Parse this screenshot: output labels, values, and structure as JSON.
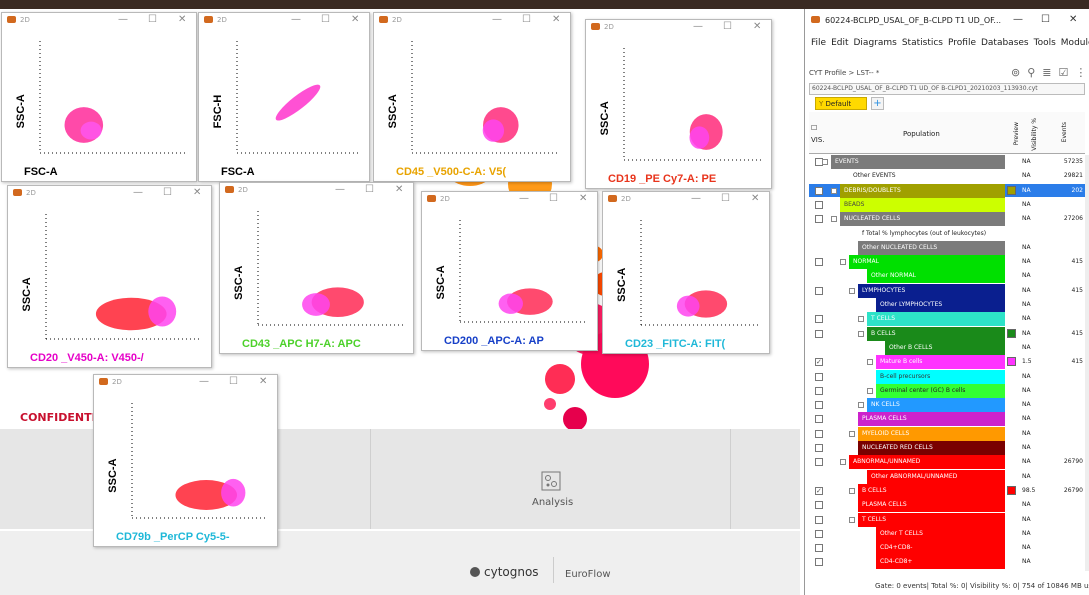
{
  "os": {
    "topbar_color": "#3a2a22"
  },
  "background_app": {
    "confidential_label": "CONFIDENTIAL:",
    "analysis_label": "Analysis",
    "brand_cytognos": "cytognos",
    "brand_euroflow": "EuroFlow"
  },
  "plots": [
    {
      "title": "2D",
      "x_label": "FSC-A",
      "y_label": "SSC-A",
      "x_color": "#000000",
      "shape": "cluster_low_left"
    },
    {
      "title": "2D",
      "x_label": "FSC-A",
      "y_label": "FSC-H",
      "x_color": "#000000",
      "shape": "diagonal"
    },
    {
      "title": "2D",
      "x_label": "CD45 _V500-C-A: V5(",
      "y_label": "SSC-A",
      "x_color": "#e8a300",
      "shape": "cluster_right"
    },
    {
      "title": "2D",
      "x_label": "CD19 _PE Cy7-A: PE",
      "y_label": "SSC-A",
      "x_color": "#e8341c",
      "shape": "cluster_right"
    },
    {
      "title": "2D",
      "x_label": "CD20 _V450-A: V450-/",
      "y_label": "SSC-A",
      "x_color": "#e600c8",
      "shape": "cluster_spread"
    },
    {
      "title": "2D",
      "x_label": "CD43 _APC H7-A: APC",
      "y_label": "SSC-A",
      "x_color": "#4cd12a",
      "shape": "cluster_mid"
    },
    {
      "title": "2D",
      "x_label": "CD200 _APC-A: AP",
      "y_label": "SSC-A",
      "x_color": "#1740c8",
      "shape": "cluster_mid"
    },
    {
      "title": "2D",
      "x_label": "CD23 _FITC-A: FIT(",
      "y_label": "SSC-A",
      "x_color": "#1fb8d8",
      "shape": "cluster_mid"
    },
    {
      "title": "2D",
      "x_label": "CD79b _PerCP Cy5-5-",
      "y_label": "SSC-A",
      "x_color": "#1fb8d8",
      "shape": "cluster_spread"
    }
  ],
  "panel": {
    "title": "60224-BCLPD_USAL_OF_B-CLPD T1 UD_OF...",
    "menu": [
      "File",
      "Edit",
      "Diagrams",
      "Statistics",
      "Profile",
      "Databases",
      "Tools",
      "Modules",
      "Help"
    ],
    "breadcrumb": "CYT Profile > LST-- *",
    "file_path": "60224-BCLPD_USAL_OF_B-CLPD T1 UD_OF B-CLPD1_20210203_113930.cyt",
    "tab": "Default Tree",
    "col_vis": "VIS.",
    "col_population": "Population",
    "col_preview": "Preview",
    "col_visibility": "Visibility %",
    "col_events": "Events",
    "status": "Gate: 0 events| Total %: 0| Visibility %: 0| 754 of 10846 MB used",
    "rows": [
      {
        "label": "EVENTS",
        "bg": "#7b7b7b",
        "fg": "#ffffff",
        "indent": 0,
        "vis": "NA",
        "ev": "57235",
        "cb": true,
        "checked": false,
        "exp": true
      },
      {
        "label": "Other EVENTS",
        "bg": "#ffffff",
        "fg": "#222222",
        "indent": 2,
        "vis": "NA",
        "ev": "29821",
        "cb": false,
        "checked": false,
        "exp": false
      },
      {
        "label": "DEBRIS/DOUBLETS",
        "bg": "#a0a000",
        "fg": "#ffffff",
        "indent": 1,
        "vis": "NA",
        "ev": "202",
        "cb": true,
        "checked": false,
        "exp": true,
        "selected": true
      },
      {
        "label": "BEADS",
        "bg": "#ccff00",
        "fg": "#444444",
        "indent": 1,
        "vis": "NA",
        "ev": "",
        "cb": true,
        "checked": false,
        "exp": false
      },
      {
        "label": "NUCLEATED CELLS",
        "bg": "#7b7b7b",
        "fg": "#ffffff",
        "indent": 1,
        "vis": "NA",
        "ev": "27206",
        "cb": true,
        "checked": false,
        "exp": true
      },
      {
        "label": "f  Total % lymphocytes (out of leukocytes)",
        "bg": "#ffffff",
        "fg": "#222222",
        "indent": 3,
        "vis": "",
        "ev": "",
        "cb": false,
        "checked": false,
        "exp": false
      },
      {
        "label": "Other NUCLEATED CELLS",
        "bg": "#7b7b7b",
        "fg": "#ffffff",
        "indent": 3,
        "vis": "NA",
        "ev": "",
        "cb": false,
        "checked": false,
        "exp": false
      },
      {
        "label": "NORMAL",
        "bg": "#00e000",
        "fg": "#ffffff",
        "indent": 2,
        "vis": "NA",
        "ev": "415",
        "cb": true,
        "checked": false,
        "exp": true
      },
      {
        "label": "Other NORMAL",
        "bg": "#00e000",
        "fg": "#ffffff",
        "indent": 4,
        "vis": "NA",
        "ev": "",
        "cb": false,
        "checked": false,
        "exp": false
      },
      {
        "label": "LYMPHOCYTES",
        "bg": "#0a1f8f",
        "fg": "#ffffff",
        "indent": 3,
        "vis": "NA",
        "ev": "415",
        "cb": true,
        "checked": false,
        "exp": true
      },
      {
        "label": "Other LYMPHOCYTES",
        "bg": "#0a1f8f",
        "fg": "#ffffff",
        "indent": 5,
        "vis": "NA",
        "ev": "",
        "cb": false,
        "checked": false,
        "exp": false
      },
      {
        "label": "T CELLS",
        "bg": "#2de3c8",
        "fg": "#ffffff",
        "indent": 4,
        "vis": "NA",
        "ev": "",
        "cb": true,
        "checked": false,
        "exp": true
      },
      {
        "label": "B CELLS",
        "bg": "#1a8a1a",
        "fg": "#ffffff",
        "indent": 4,
        "vis": "NA",
        "ev": "415",
        "cb": true,
        "checked": false,
        "exp": true
      },
      {
        "label": "Other B CELLS",
        "bg": "#1a8a1a",
        "fg": "#ffffff",
        "indent": 6,
        "vis": "NA",
        "ev": "",
        "cb": false,
        "checked": false,
        "exp": false
      },
      {
        "label": "Mature B cells",
        "bg": "#ff33ff",
        "fg": "#ffffff",
        "indent": 5,
        "vis": "1.5",
        "ev": "415",
        "cb": true,
        "checked": true,
        "exp": true
      },
      {
        "label": "B-cell precursors",
        "bg": "#00ffff",
        "fg": "#333333",
        "indent": 5,
        "vis": "NA",
        "ev": "",
        "cb": true,
        "checked": false,
        "exp": false
      },
      {
        "label": "Germinal center (GC) B cells",
        "bg": "#33ff33",
        "fg": "#222222",
        "indent": 5,
        "vis": "NA",
        "ev": "",
        "cb": true,
        "checked": false,
        "exp": true
      },
      {
        "label": "NK CELLS",
        "bg": "#2299ff",
        "fg": "#ffffff",
        "indent": 4,
        "vis": "NA",
        "ev": "",
        "cb": true,
        "checked": false,
        "exp": true
      },
      {
        "label": "PLASMA CELLS",
        "bg": "#cc22cc",
        "fg": "#ffffff",
        "indent": 3,
        "vis": "NA",
        "ev": "",
        "cb": true,
        "checked": false,
        "exp": false
      },
      {
        "label": "MYELOID CELLS",
        "bg": "#ff9900",
        "fg": "#ffffff",
        "indent": 3,
        "vis": "NA",
        "ev": "",
        "cb": true,
        "checked": false,
        "exp": true
      },
      {
        "label": "NUCLEATED RED CELLS",
        "bg": "#7a0000",
        "fg": "#ffffff",
        "indent": 3,
        "vis": "NA",
        "ev": "",
        "cb": true,
        "checked": false,
        "exp": false
      },
      {
        "label": "ABNORMAL/UNNAMED",
        "bg": "#ff0000",
        "fg": "#ffffff",
        "indent": 2,
        "vis": "NA",
        "ev": "26790",
        "cb": true,
        "checked": false,
        "exp": true
      },
      {
        "label": "Other ABNORMAL/UNNAMED",
        "bg": "#ff0000",
        "fg": "#ffffff",
        "indent": 4,
        "vis": "NA",
        "ev": "",
        "cb": false,
        "checked": false,
        "exp": false
      },
      {
        "label": "B CELLS",
        "bg": "#ff0000",
        "fg": "#ffffff",
        "indent": 3,
        "vis": "98.5",
        "ev": "26790",
        "cb": true,
        "checked": true,
        "exp": true
      },
      {
        "label": "PLASMA CELLS",
        "bg": "#ff0000",
        "fg": "#ffffff",
        "indent": 3,
        "vis": "NA",
        "ev": "",
        "cb": true,
        "checked": false,
        "exp": false
      },
      {
        "label": "T CELLS",
        "bg": "#ff0000",
        "fg": "#ffffff",
        "indent": 3,
        "vis": "NA",
        "ev": "",
        "cb": true,
        "checked": false,
        "exp": true
      },
      {
        "label": "Other T CELLS",
        "bg": "#ff0000",
        "fg": "#ffffff",
        "indent": 5,
        "vis": "NA",
        "ev": "",
        "cb": true,
        "checked": false,
        "exp": false
      },
      {
        "label": "CD4+CD8-",
        "bg": "#ff0000",
        "fg": "#ffffff",
        "indent": 5,
        "vis": "NA",
        "ev": "",
        "cb": true,
        "checked": false,
        "exp": false
      },
      {
        "label": "CD4-CD8+",
        "bg": "#ff0000",
        "fg": "#ffffff",
        "indent": 5,
        "vis": "NA",
        "ev": "",
        "cb": true,
        "checked": false,
        "exp": false
      }
    ]
  }
}
